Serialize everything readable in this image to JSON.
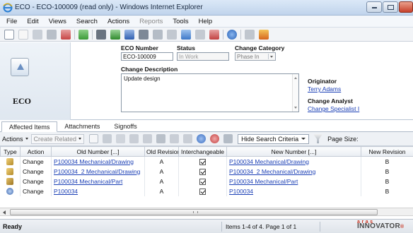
{
  "window": {
    "title": "ECO - ECO-100009 (read only) - Windows Internet Explorer",
    "icons": {
      "app": "ie-icon",
      "minimize": "minimize-icon",
      "maximize": "maximize-icon",
      "close": "close-icon"
    }
  },
  "menu": {
    "items": [
      {
        "label": "File",
        "enabled": true
      },
      {
        "label": "Edit",
        "enabled": true
      },
      {
        "label": "Views",
        "enabled": true
      },
      {
        "label": "Search",
        "enabled": true
      },
      {
        "label": "Actions",
        "enabled": true
      },
      {
        "label": "Reports",
        "enabled": false
      },
      {
        "label": "Tools",
        "enabled": true
      },
      {
        "label": "Help",
        "enabled": true
      }
    ]
  },
  "toolbar": {
    "icons": [
      "new-icon",
      "new-disabled-icon",
      "open-icon",
      "save-icon",
      "delete-icon",
      "refresh-icon",
      "print-icon",
      "export-excel-icon",
      "export-word-icon",
      "lock-icon",
      "unlock-icon",
      "undo-icon",
      "promote-icon",
      "where-used-icon",
      "structure-icon",
      "help-icon",
      "signature-icon",
      "start-workflow-icon"
    ]
  },
  "form": {
    "item_label": "ECO",
    "item_icon": "eco-icon",
    "eco_number_label": "ECO Number",
    "eco_number_value": "ECO-100009",
    "status_label": "Status",
    "status_value": "In Work",
    "change_category_label": "Change Category",
    "change_category_value": "Phase In",
    "change_description_label": "Change Description",
    "change_description_value": "Update design",
    "originator_label": "Originator",
    "originator_value": "Terry Adams",
    "change_analyst_label": "Change Analyst",
    "change_analyst_value": "Change Specialist I"
  },
  "tabs": [
    {
      "label": "Affected Items",
      "active": true
    },
    {
      "label": "Attachments",
      "active": false
    },
    {
      "label": "Signoffs",
      "active": false
    }
  ],
  "grid_toolbar": {
    "actions_label": "Actions",
    "create_related_label": "Create Related",
    "hide_search_label": "Hide Search Criteria",
    "page_size_label": "Page Size:",
    "icons": [
      "new-row-icon",
      "pick-icon",
      "remove-icon",
      "excel-icon",
      "word-icon",
      "lock-icon",
      "unlock-icon",
      "pin-icon",
      "search-icon",
      "clear-search-icon",
      "filter-icon"
    ]
  },
  "grid": {
    "columns": [
      "Type",
      "Action",
      "Old Number [...]",
      "Old Revision",
      "Interchangeable",
      "New Number [...]",
      "New Revision"
    ],
    "rows": [
      {
        "type_icon": "mechanical-drawing-icon",
        "action": "Change",
        "old_number": "P100034 Mechanical/Drawing",
        "old_revision": "A",
        "interchangeable": true,
        "new_number": "P100034 Mechanical/Drawing",
        "new_revision": "B"
      },
      {
        "type_icon": "mechanical-drawing-icon",
        "action": "Change",
        "old_number": "P100034_2 Mechanical/Drawing",
        "old_revision": "A",
        "interchangeable": true,
        "new_number": "P100034_2 Mechanical/Drawing",
        "new_revision": "B"
      },
      {
        "type_icon": "mechanical-part-icon",
        "action": "Change",
        "old_number": "P100034 Mechanical/Part",
        "old_revision": "A",
        "interchangeable": true,
        "new_number": "P100034 Mechanical/Part",
        "new_revision": "B"
      },
      {
        "type_icon": "part-icon",
        "action": "Change",
        "old_number": "P100034",
        "old_revision": "A",
        "interchangeable": true,
        "new_number": "P100034",
        "new_revision": "B"
      }
    ]
  },
  "status": {
    "left": "Ready",
    "items_info": "Items 1-4 of 4. Page 1 of 1",
    "brand": "INNOVATOR",
    "brand_prefix": "a r a s",
    "brand_tm": "®"
  },
  "colors": {
    "link": "#1b3fb5",
    "accent_red": "#c8321f"
  }
}
